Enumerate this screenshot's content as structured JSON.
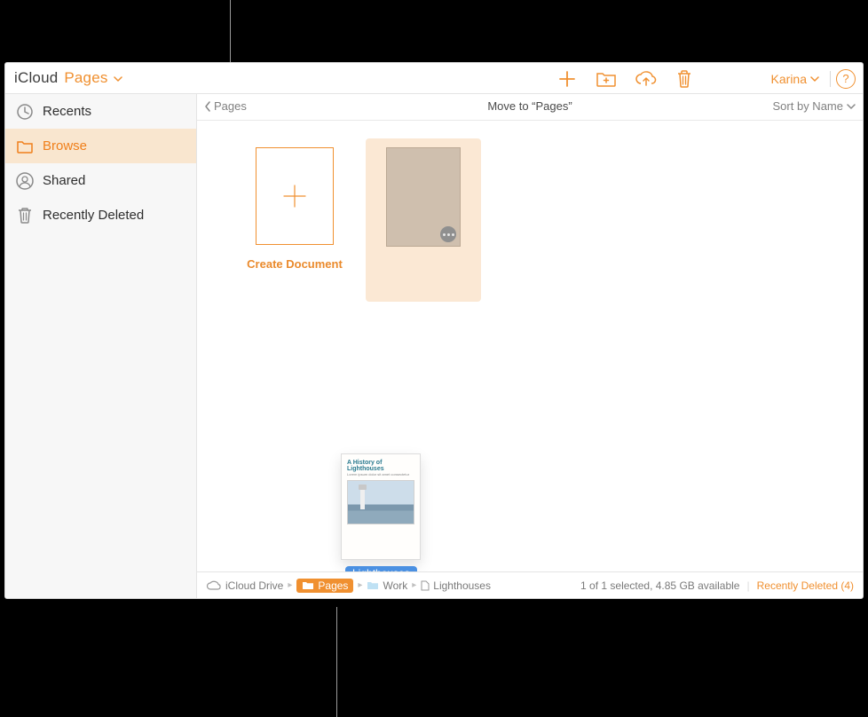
{
  "brand": {
    "primary": "iCloud",
    "app": "Pages"
  },
  "toolbar_user": "Karina",
  "sidebar": {
    "items": [
      {
        "label": "Recents"
      },
      {
        "label": "Browse"
      },
      {
        "label": "Shared"
      },
      {
        "label": "Recently Deleted"
      }
    ],
    "selected_index": 1
  },
  "subheader": {
    "back_label": "Pages",
    "title": "Move to “Pages”",
    "sort_label": "Sort by Name"
  },
  "create_label": "Create Document",
  "ghost_doc": {
    "title": "A History of Lighthouses",
    "subtitle": "Lorem ipsum dolor sit amet consectetur"
  },
  "drag_tip": "Lighthouses",
  "path": {
    "seg0": "iCloud Drive",
    "seg1": "Pages",
    "seg2": "Work",
    "seg3": "Lighthouses"
  },
  "status": {
    "info": "1 of 1 selected, 4.85 GB available",
    "recently_deleted": "Recently Deleted (4)"
  }
}
